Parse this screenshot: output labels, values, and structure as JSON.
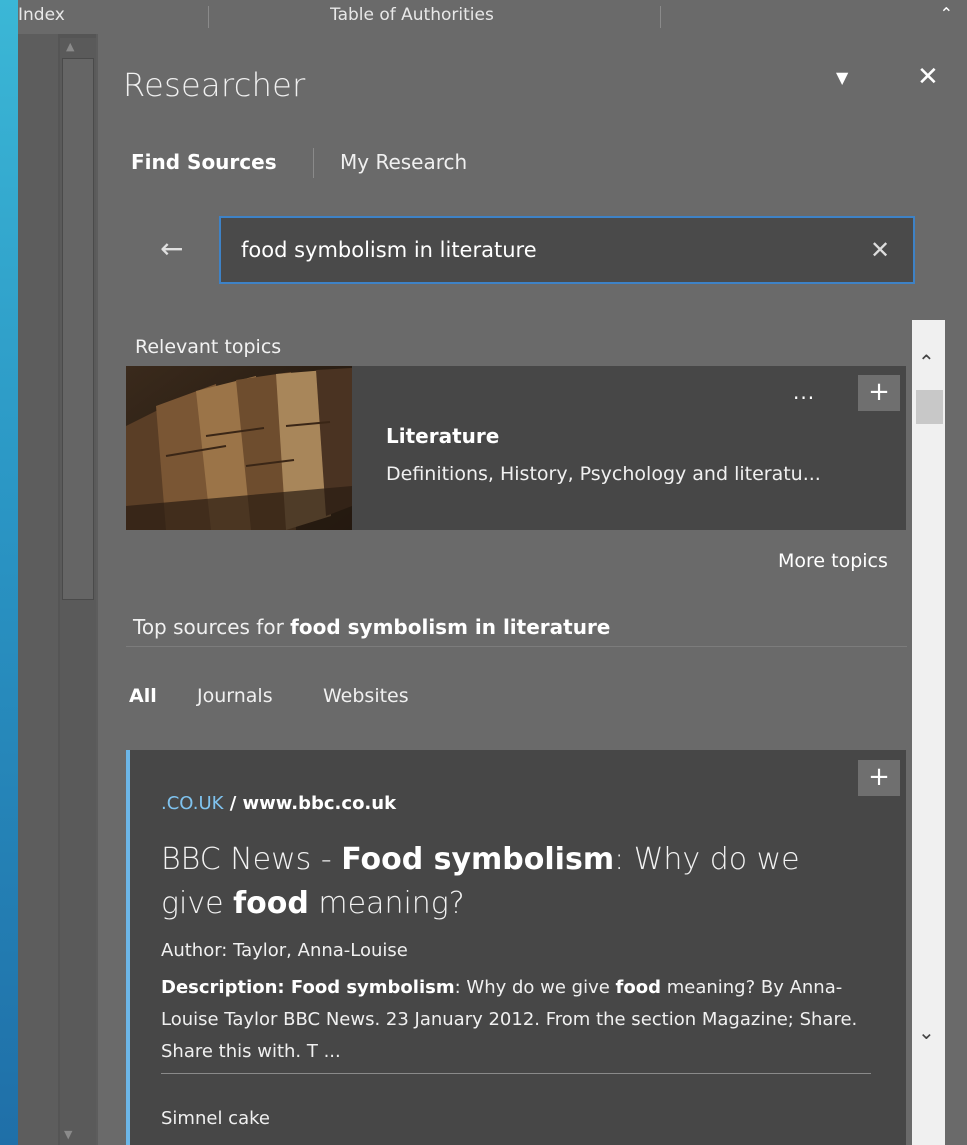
{
  "ribbon": {
    "tab_index": "Index",
    "tab_authorities": "Table of Authorities",
    "collapse_icon": "chevron-up-icon"
  },
  "pane": {
    "title": "Researcher",
    "tabs": {
      "find_sources": "Find Sources",
      "my_research": "My Research"
    }
  },
  "search": {
    "value": "food symbolism in literature"
  },
  "relevant": {
    "heading": "Relevant topics",
    "topic": {
      "title": "Literature",
      "description": "Definitions, History, Psychology and literatu...",
      "more_glyph": "...",
      "add_glyph": "+"
    },
    "more_topics": "More topics"
  },
  "top_sources": {
    "prefix": "Top sources for ",
    "query": "food symbolism in literature",
    "filters": {
      "all": "All",
      "journals": "Journals",
      "websites": "Websites"
    }
  },
  "result": {
    "domain": ".CO.UK",
    "url": " / www.bbc.co.uk",
    "title_1": "BBC News - ",
    "title_2": "Food symbolism",
    "title_3": ": Why do we give ",
    "title_4": "food",
    "title_5": " meaning?",
    "author": "Author: Taylor, Anna-Louise",
    "desc_label": "Description: ",
    "desc_b1": "Food symbolism",
    "desc_t1": ": Why do we give ",
    "desc_b2": "food",
    "desc_t2": " meaning? By Anna-Louise Taylor BBC News. 23 January 2012. From the section Magazine; Share. Share this with. T ...",
    "footer": "Simnel cake",
    "add_glyph": "+"
  },
  "colors": {
    "accent": "#6cb6e7",
    "search_border": "#3e82c6",
    "domain": "#7fc3ef"
  }
}
